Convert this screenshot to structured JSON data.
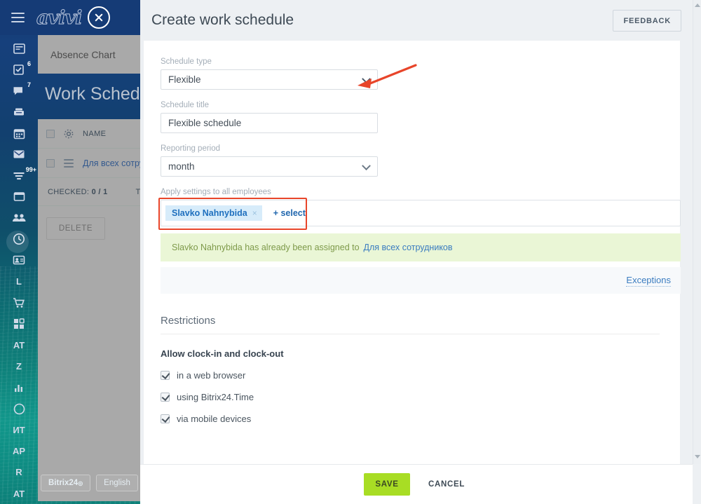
{
  "background_app": {
    "brand": "avivi",
    "icons": {
      "menu": "hamburger-icon",
      "close": "close-circle-icon"
    },
    "rail_items": [
      {
        "name": "feed-icon",
        "glyph": "feed",
        "badge": ""
      },
      {
        "name": "tasks-icon",
        "glyph": "tasks",
        "badge": "6"
      },
      {
        "name": "chat-icon",
        "glyph": "chat",
        "badge": "7"
      },
      {
        "name": "drive-icon",
        "glyph": "drive",
        "badge": ""
      },
      {
        "name": "calendar-icon",
        "glyph": "calendar",
        "badge": ""
      },
      {
        "name": "mail-icon",
        "glyph": "mail",
        "badge": ""
      },
      {
        "name": "funnel-icon",
        "glyph": "funnel",
        "badge": "99+"
      },
      {
        "name": "window-icon",
        "glyph": "window",
        "badge": ""
      },
      {
        "name": "employees-icon",
        "glyph": "people",
        "badge": ""
      },
      {
        "name": "time-icon",
        "glyph": "clock",
        "badge": ""
      },
      {
        "name": "contacts-icon",
        "glyph": "contacts",
        "badge": ""
      },
      {
        "name": "app-letter-l",
        "glyph": "L",
        "badge": ""
      },
      {
        "name": "shop-icon",
        "glyph": "cart",
        "badge": ""
      },
      {
        "name": "apps-icon",
        "glyph": "grid",
        "badge": ""
      },
      {
        "name": "app-letters-at",
        "glyph": "AT",
        "badge": ""
      },
      {
        "name": "app-letter-z",
        "glyph": "Z",
        "badge": ""
      },
      {
        "name": "reports-icon",
        "glyph": "bars",
        "badge": ""
      },
      {
        "name": "moon-clock-icon",
        "glyph": "moon",
        "badge": ""
      },
      {
        "name": "app-letters-it",
        "glyph": "ИТ",
        "badge": ""
      },
      {
        "name": "app-letters-ap",
        "glyph": "AP",
        "badge": ""
      },
      {
        "name": "app-letter-r",
        "glyph": "R",
        "badge": ""
      },
      {
        "name": "app-letters-at2",
        "glyph": "AT",
        "badge": ""
      }
    ],
    "subnav_label": "Absence Chart",
    "page_title": "Work Schedule",
    "grid": {
      "header_name": "NAME",
      "row_name": "Для всех сотру…",
      "checked_label": "CHECKED:",
      "checked_value": "0 / 1",
      "total_label": "TO",
      "delete_label": "DELETE"
    },
    "footer_pills": [
      "Bitrix24",
      "English"
    ]
  },
  "modal": {
    "title": "Create work schedule",
    "feedback_label": "FEEDBACK",
    "fields": {
      "schedule_type": {
        "label": "Schedule type",
        "value": "Flexible"
      },
      "schedule_title": {
        "label": "Schedule title",
        "value": "Flexible schedule"
      },
      "reporting_period": {
        "label": "Reporting period",
        "value": "month"
      },
      "apply_to": {
        "label": "Apply settings to all employees",
        "chip": "Slavko Nahnybida",
        "chip_remove": "×",
        "select_link": "+ select"
      }
    },
    "notice": {
      "text": "Slavko Nahnybida has already been assigned to",
      "link": "Для всех сотрудников"
    },
    "exceptions_link": "Exceptions",
    "restrictions": {
      "section_title": "Restrictions",
      "group_title": "Allow clock-in and clock-out",
      "options": [
        {
          "label": "in a web browser",
          "checked": true
        },
        {
          "label": "using Bitrix24.Time",
          "checked": true
        },
        {
          "label": "via mobile devices",
          "checked": true
        }
      ]
    },
    "footer": {
      "save_label": "SAVE",
      "cancel_label": "CANCEL"
    }
  },
  "annotation": {
    "name": "red-pointer-arrow",
    "color": "#e8452a",
    "points_at": "schedule-type-dropdown-chevron"
  },
  "colors": {
    "accent_blue": "#2167ae",
    "save_green": "#a8dd24",
    "notice_green_bg": "#eaf6d6",
    "highlight_red": "#e8452a",
    "header_blue": "#153b76"
  }
}
